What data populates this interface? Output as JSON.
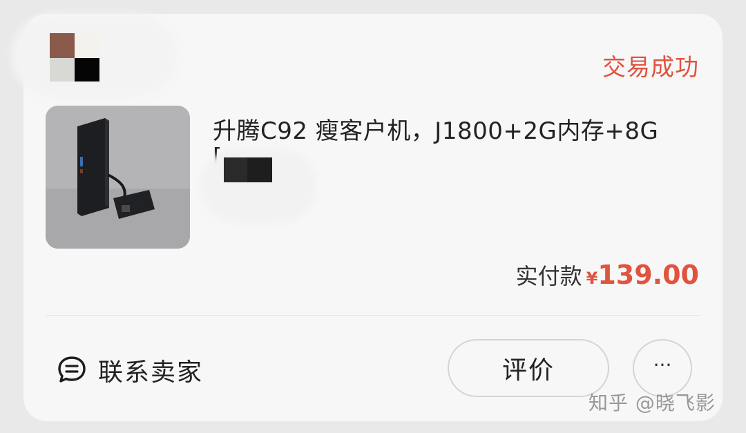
{
  "order": {
    "status": "交易成功",
    "product_title_line1": "升腾C92  瘦客户机，J1800+2G内存+8G",
    "product_title_line2": "[",
    "price_label": "实付款",
    "price_currency": "¥",
    "price_value": "139.00"
  },
  "actions": {
    "contact_seller": "联系卖家",
    "review": "评价",
    "more": "···"
  },
  "watermark": "知乎 @晓飞影",
  "colors": {
    "accent": "#e0533f",
    "card_bg": "#f7f7f7",
    "page_bg": "#e9e9e9"
  },
  "icons": {
    "contact": "chat-bubble-icon",
    "more": "ellipsis-icon"
  }
}
